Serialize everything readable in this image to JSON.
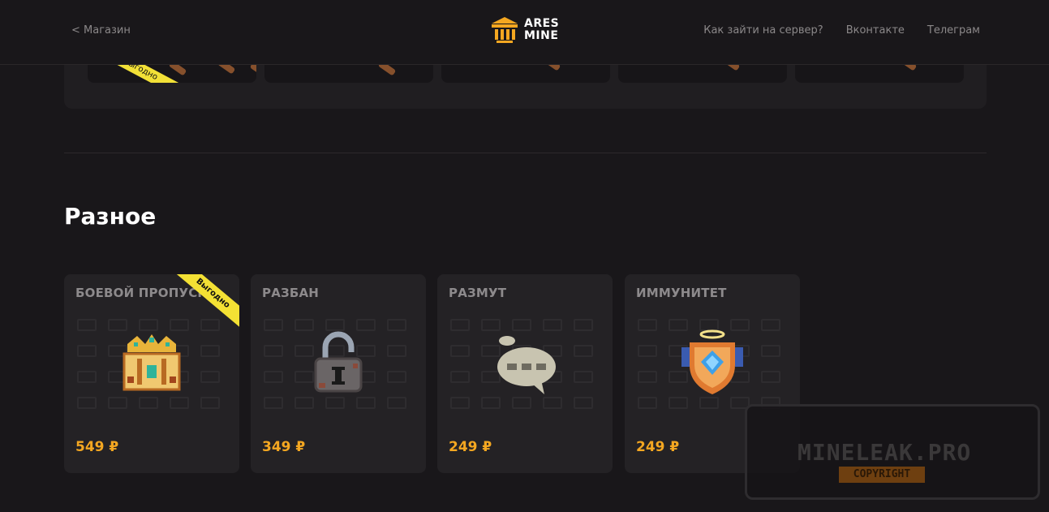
{
  "header": {
    "back_link": "< Магазин",
    "logo_line1": "ARES",
    "logo_line2": "MINE",
    "nav": [
      "Как зайти на сервер?",
      "Вконтакте",
      "Телеграм"
    ]
  },
  "prev_section": {
    "ribbon": "Выгодно"
  },
  "section": {
    "title": "Разное"
  },
  "products": [
    {
      "title": "БОЕВОЙ ПРОПУСК",
      "price": "549 ₽",
      "ribbon": "Выгодно",
      "icon": "battle-pass-crown-icon"
    },
    {
      "title": "РАЗБАН",
      "price": "349 ₽",
      "icon": "unlock-padlock-icon"
    },
    {
      "title": "РАЗМУТ",
      "price": "249 ₽",
      "icon": "chat-bubble-icon"
    },
    {
      "title": "ИММУНИТЕТ",
      "price": "249 ₽",
      "icon": "shield-halo-icon"
    }
  ],
  "watermark": {
    "title": "MINELEAK.PRO",
    "sub": "COPYRIGHT"
  },
  "colors": {
    "background": "#19171a",
    "card": "#242225",
    "price": "#f4a721",
    "ribbon": "#f4e134",
    "logo_accent": "#f4a721"
  }
}
